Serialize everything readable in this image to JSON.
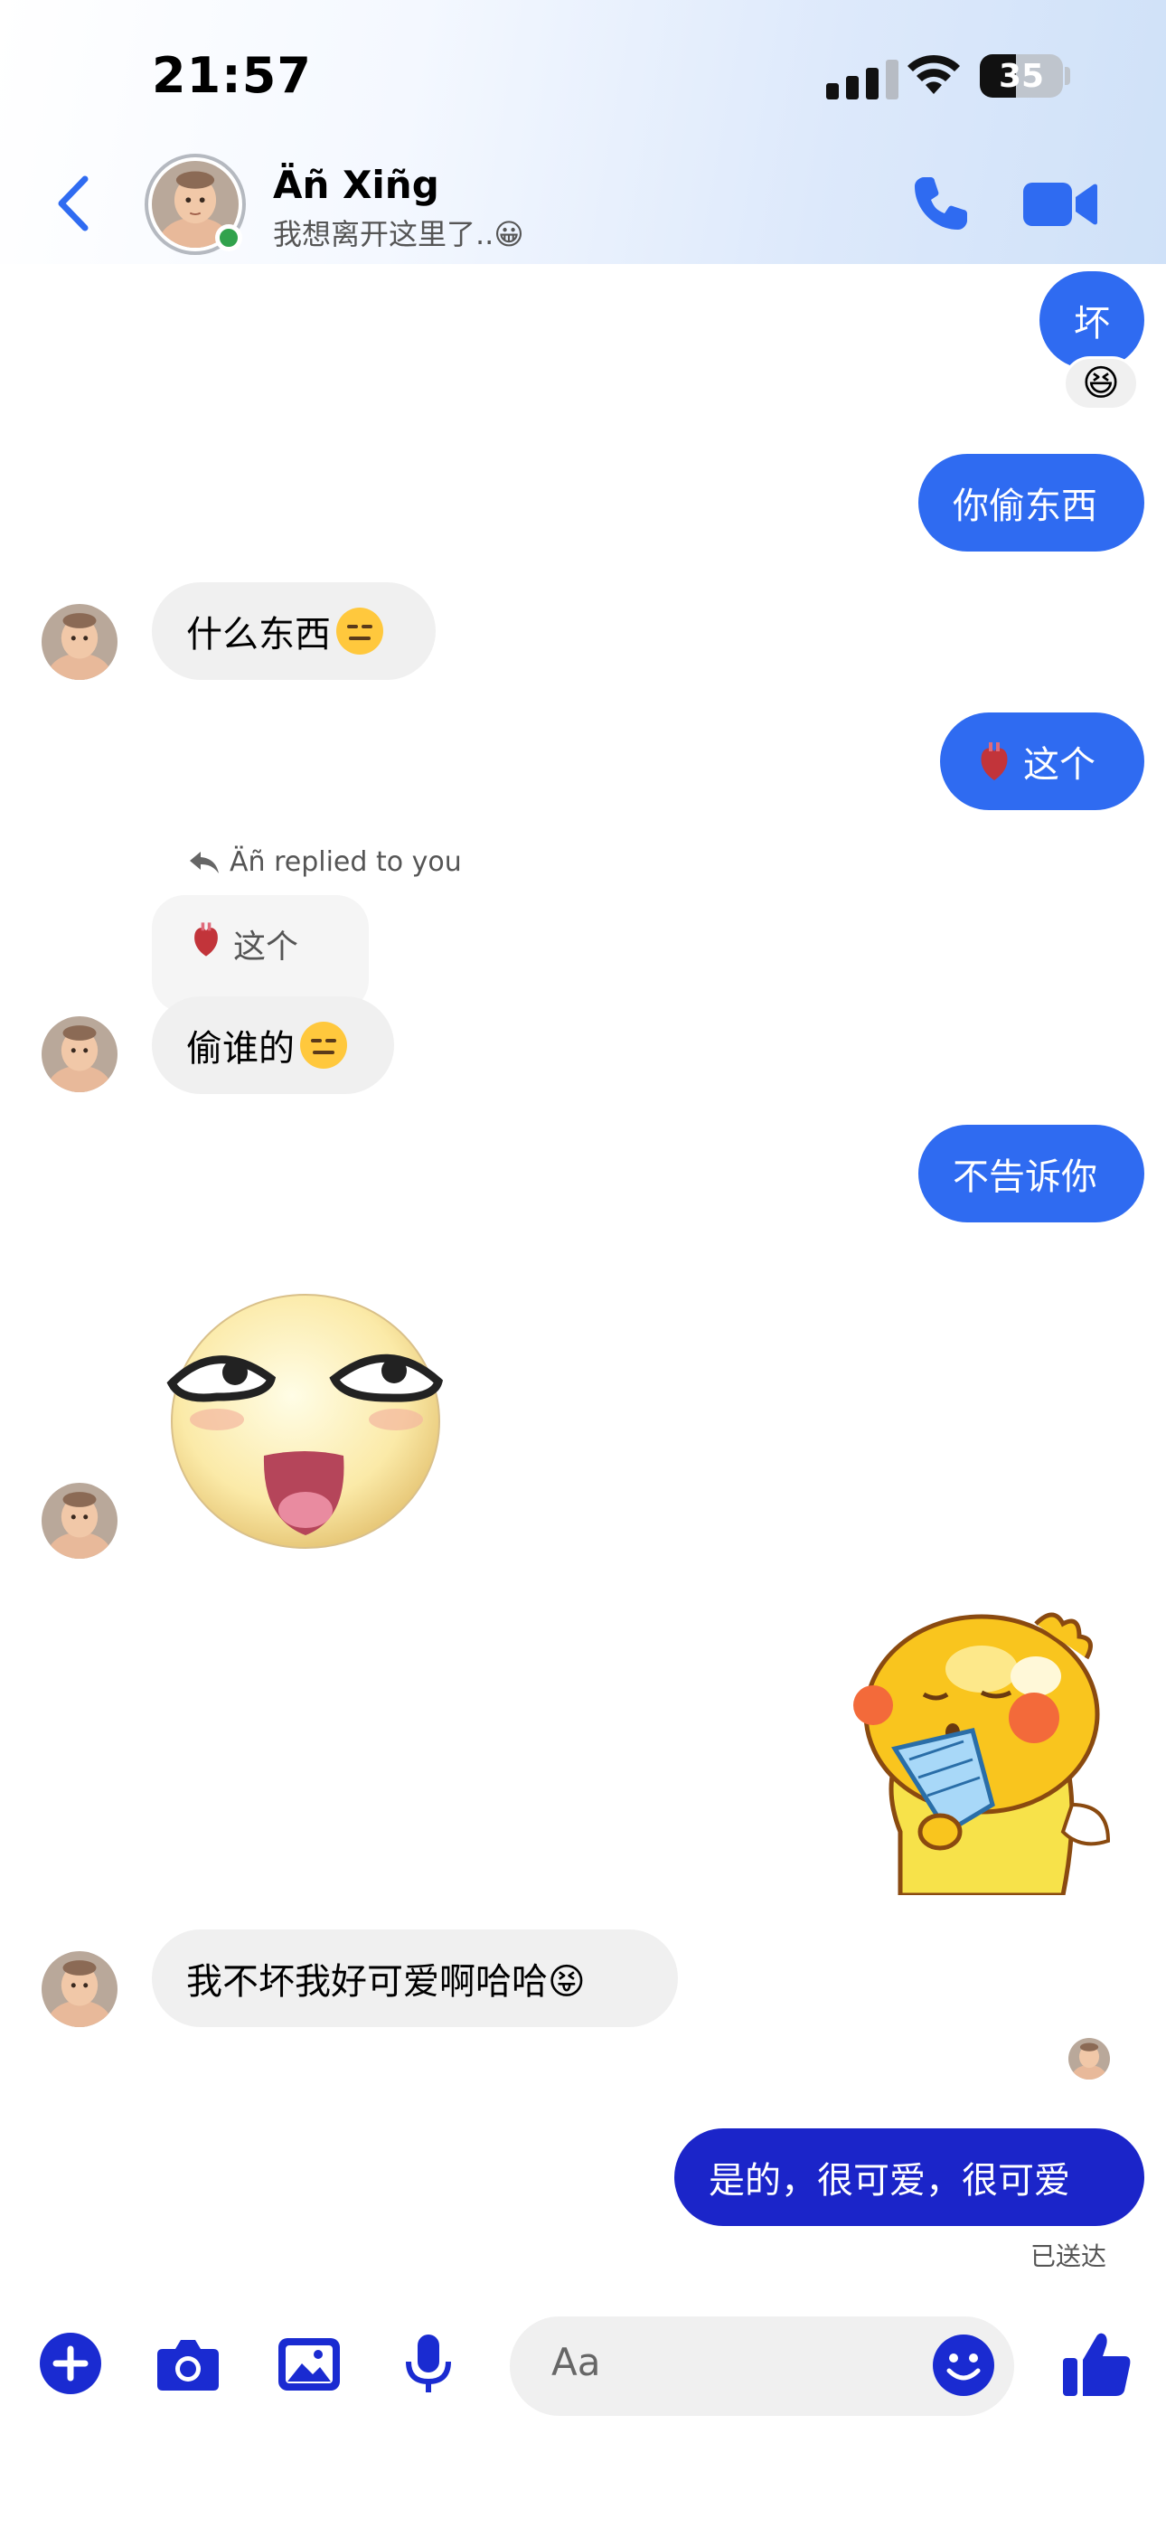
{
  "status_bar": {
    "time": "21:57",
    "battery": "35"
  },
  "header": {
    "contact_name": "Äñ Xiñg",
    "contact_status": "我想离开这里了..😀",
    "icons": [
      "chevron-left-icon",
      "phone-icon",
      "video-camera-icon"
    ]
  },
  "messages": {
    "m1": {
      "text": "坏",
      "reaction": "😆"
    },
    "m2": {
      "text": "你偷东西"
    },
    "m3": {
      "text": "什么东西"
    },
    "m4": {
      "text": "这个"
    },
    "reply": {
      "label": "Äñ replied to you",
      "quoted": "这个"
    },
    "m5": {
      "text": "偷谁的"
    },
    "m6": {
      "text": "不告诉你"
    },
    "m7": {
      "text": "我不坏我好可爱啊哈哈😝"
    },
    "m8": {
      "text": "是的，很可爱，很可爱",
      "status": "已送达"
    }
  },
  "composer": {
    "placeholder": "Aa",
    "icons": [
      "plus-icon",
      "camera-icon",
      "image-icon",
      "microphone-icon",
      "emoji-icon",
      "thumbs-up-icon"
    ]
  },
  "colors": {
    "outgoing": "#2f6bf1",
    "outgoing_latest": "#1b25c9",
    "incoming": "#f0f0f0",
    "accent": "#1a2bd1"
  }
}
